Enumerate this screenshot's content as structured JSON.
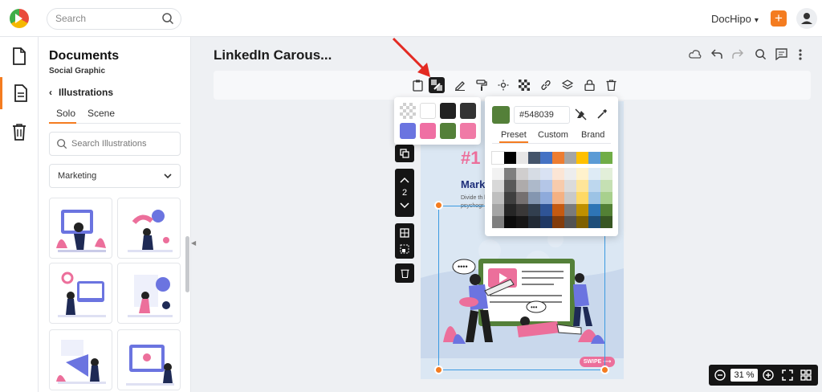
{
  "topbar": {
    "search_placeholder": "Search",
    "brand": "DocHipo"
  },
  "panel": {
    "title": "Documents",
    "subtitle": "Social Graphic",
    "back_label": "Illustrations",
    "tabs": [
      "Solo",
      "Scene"
    ],
    "search_placeholder": "Search Illustrations",
    "category": "Marketing"
  },
  "document": {
    "title": "LinkedIn Carous..."
  },
  "page": {
    "number": "#1",
    "heading": "Mark",
    "paragraph": "Divide th based on psychogr potential",
    "swipe": "SWIPE"
  },
  "side_controls": {
    "page_index": "2"
  },
  "swatches": [
    "checker",
    "#ffffff",
    "#222222",
    "#333333",
    "#6b74e0",
    "#ef6fa3",
    "#548039",
    "#f07aa6"
  ],
  "picker": {
    "current_color": "#548039",
    "hex_value": "#548039",
    "tabs": [
      "Preset",
      "Custom",
      "Brand"
    ],
    "top_row": [
      "#ffffff",
      "#000000",
      "#e7e6e6",
      "#44546a",
      "#4472c4",
      "#ed7d31",
      "#a5a5a5",
      "#ffc000",
      "#5b9bd5",
      "#70ad47"
    ],
    "shade_rows": [
      [
        "#f2f2f2",
        "#7f7f7f",
        "#d0cece",
        "#d6dce4",
        "#d9e2f3",
        "#fbe5d5",
        "#ededed",
        "#fff2cc",
        "#deebf6",
        "#e2efd9"
      ],
      [
        "#d8d8d8",
        "#595959",
        "#aeabab",
        "#adb9ca",
        "#b4c6e7",
        "#f7cbac",
        "#dbdbdb",
        "#fee599",
        "#bdd7ee",
        "#c5e0b3"
      ],
      [
        "#bfbfbf",
        "#3f3f3f",
        "#757070",
        "#8496b0",
        "#8eaadb",
        "#f4b183",
        "#c9c9c9",
        "#ffd965",
        "#9cc3e5",
        "#a8d08d"
      ],
      [
        "#a5a5a5",
        "#262626",
        "#3a3838",
        "#323f4f",
        "#2f5496",
        "#c55a11",
        "#7b7b7b",
        "#bf9000",
        "#2e75b5",
        "#538135"
      ],
      [
        "#7f7f7f",
        "#0c0c0c",
        "#171616",
        "#222a35",
        "#1f3864",
        "#833c0b",
        "#525252",
        "#7f6000",
        "#1e4e79",
        "#375623"
      ]
    ]
  },
  "zoom": {
    "value": "31 %"
  },
  "colors": {
    "accent": "#f47c20",
    "selection": "#3b9ae1",
    "page_bg": "#dbe7f3"
  }
}
